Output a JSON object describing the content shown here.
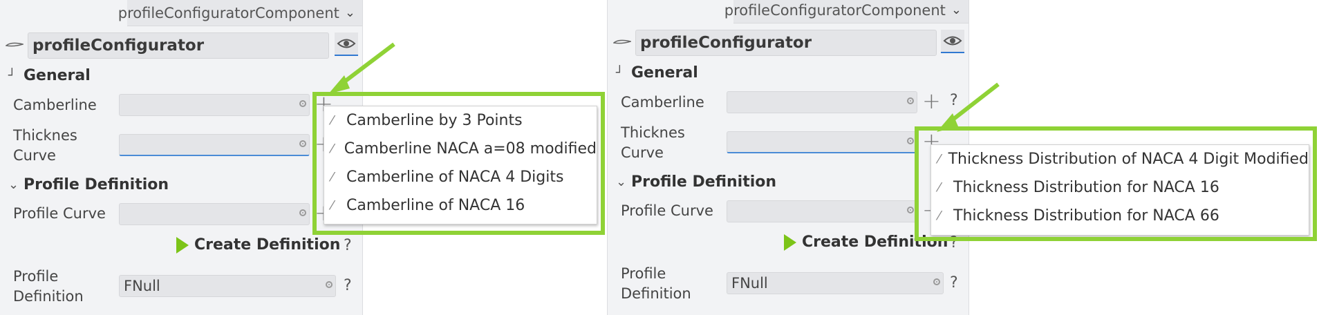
{
  "colors": {
    "accent": "#8fd236",
    "play": "#7cc418",
    "focus": "#2f78d1"
  },
  "left": {
    "component_select": "profileConfiguratorComponent",
    "object_name": "profileConfigurator",
    "general": "General",
    "camberline_label": "Camberline",
    "thickness_label_1": "Thicknes",
    "thickness_label_2": "Curve",
    "profile_definition_section": "Profile Definition",
    "profile_curve_label": "Profile Curve",
    "create_definition": "Create Definition",
    "profile_def_label_1": "Profile",
    "profile_def_label_2": "Definition",
    "profile_def_value": "FNull",
    "help": "?",
    "menu": [
      "Camberline by 3 Points",
      "Camberline NACA a=08 modified",
      "Camberline of NACA 4 Digits",
      "Camberline of NACA 16"
    ]
  },
  "right": {
    "component_select": "profileConfiguratorComponent",
    "object_name": "profileConfigurator",
    "general": "General",
    "camberline_label": "Camberline",
    "thickness_label_1": "Thicknes",
    "thickness_label_2": "Curve",
    "profile_definition_section": "Profile Definition",
    "profile_curve_label": "Profile Curve",
    "create_definition": "Create Definition",
    "profile_def_label_1": "Profile",
    "profile_def_label_2": "Definition",
    "profile_def_value": "FNull",
    "help": "?",
    "menu": [
      "Thickness Distribution of NACA 4 Digit Modified",
      "Thickness Distribution for NACA 16",
      "Thickness Distribution for NACA 66"
    ]
  }
}
